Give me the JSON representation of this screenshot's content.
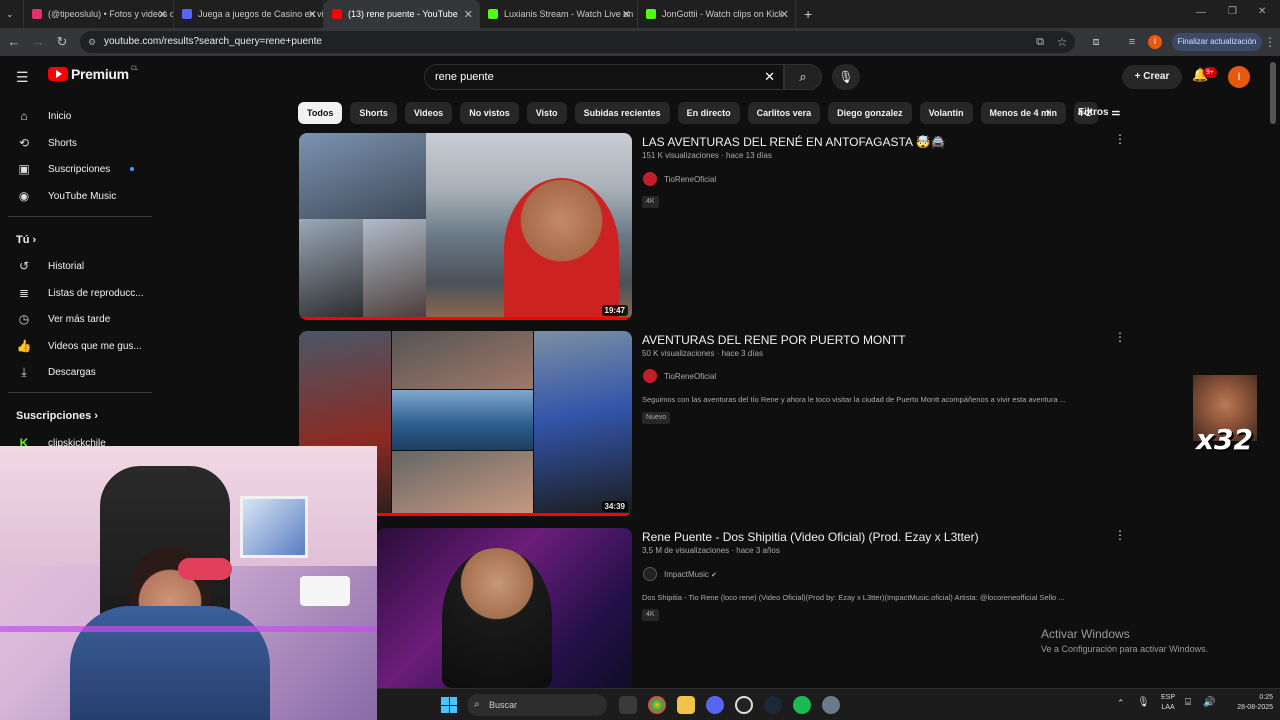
{
  "browser": {
    "tabs": [
      {
        "label": "(@tipeoslulu) • Fotos y videos d",
        "color": "#e1306c"
      },
      {
        "label": "Juega a juegos de Casino en vi",
        "color": "#5865f2"
      },
      {
        "label": "(13) rene puente - YouTube",
        "color": "#ff0000",
        "active": true
      },
      {
        "label": "Luxianis Stream - Watch Live on",
        "color": "#53fc18"
      },
      {
        "label": "JonGottii - Watch clips on Kick",
        "color": "#53fc18"
      }
    ],
    "url": "youtube.com/results?search_query=rene+puente",
    "update_label": "Finalizar actualización",
    "profile_letter": "I"
  },
  "header": {
    "logo_text": "Premium",
    "logo_country": "CL",
    "search_value": "rene puente",
    "create_label": "Crear",
    "notif_count": "9+",
    "avatar_letter": "I"
  },
  "sidebar": {
    "main": [
      "Inicio",
      "Shorts",
      "Suscripciones",
      "YouTube Music"
    ],
    "you_heading": "Tú",
    "you": [
      "Historial",
      "Listas de reproducc...",
      "Ver más tarde",
      "Videos que me gus...",
      "Descargas"
    ],
    "subs_heading": "Suscripciones",
    "subs": [
      "clipskickchile"
    ]
  },
  "chips": [
    "Todos",
    "Shorts",
    "Videos",
    "No vistos",
    "Visto",
    "Subidas recientes",
    "En directo",
    "Carlitos vera",
    "Diego gonzalez",
    "Volantin",
    "Menos de 4 min",
    "4-2"
  ],
  "filters_label": "Filtros",
  "videos": [
    {
      "title": "LAS AVENTURAS DEL RENÉ EN ANTOFAGASTA 🤯🚔",
      "meta": "151 K visualizaciones · hace 13 días",
      "channel": "TioReneOficial",
      "desc": "",
      "badge": "4K",
      "duration": "19:47"
    },
    {
      "title": "AVENTURAS DEL RENE POR PUERTO MONTT",
      "meta": "50 K visualizaciones · hace 3 días",
      "channel": "TioReneOficial",
      "desc": "Seguimos con las aventuras del tío Rene y ahora le toco visitar la ciudad de Puerto Montt acompáñenos a vivir esta aventura ...",
      "badge": "Nuevo",
      "duration": "34:39"
    },
    {
      "title": "Rene Puente - Dos Shipitia (Video Oficial) (Prod. Ezay x L3tter)",
      "meta": "3,5 M de visualizaciones · hace 3 años",
      "channel": "ImpactMusic",
      "desc": "Dos Shipitia - Tio Rene (loco rene) (Video Oficial)(Prod by: Ezay x L3tter)(ImpactMusic.oficial) Artista: @locoreneofficial Sello ...",
      "badge": "4K",
      "duration": ""
    }
  ],
  "overlay": {
    "x32": "x32"
  },
  "activate": {
    "title": "Activar Windows",
    "subtitle": "Ve a Configuración para activar Windows."
  },
  "taskbar": {
    "search_placeholder": "Buscar",
    "lang1": "ESP",
    "lang2": "LAA",
    "time": "0:25",
    "date": "28-08-2025"
  }
}
